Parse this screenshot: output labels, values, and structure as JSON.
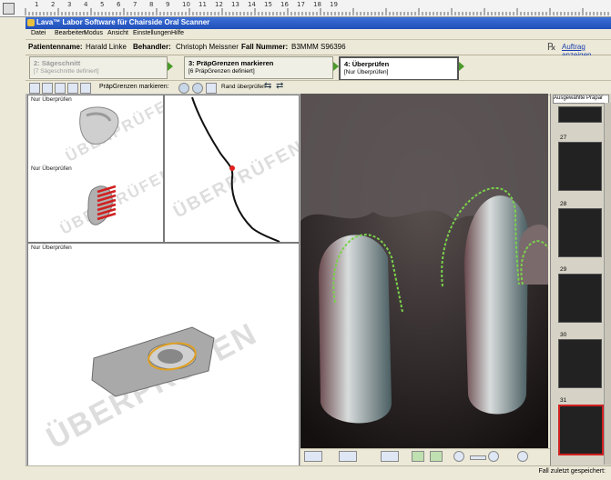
{
  "window": {
    "title": "Lava™ Labor Software für Chairside Oral Scanner"
  },
  "ruler": {
    "numbers": [
      "1",
      "2",
      "3",
      "4",
      "5",
      "6",
      "7",
      "8",
      "9",
      "10",
      "11",
      "12",
      "13",
      "14",
      "15",
      "16",
      "17",
      "18",
      "19"
    ]
  },
  "menu": [
    "Datei",
    "Bearbeiten",
    "Modus",
    "Ansicht",
    "Einstellungen",
    "Hilfe"
  ],
  "patient": {
    "name_label": "Patientenname:",
    "name": "Harald Linke",
    "doctor_label": "Behandler:",
    "doctor": "Christoph Meissner",
    "case_label": "Fall Nummer:",
    "case": "B3MMM S96396",
    "order_link": "Auftrag anzeigen"
  },
  "steps": [
    {
      "title": "2: Sägeschnitt",
      "sub": "[7 Sägeschnitte definiert]"
    },
    {
      "title": "3: PräpGrenzen markieren",
      "sub": "[6 PräpGrenzen definiert]"
    },
    {
      "title": "4: Überprüfen",
      "sub": "[Nur Überprüfen]"
    }
  ],
  "toolbar": {
    "prep_label": "PräpGrenzen markieren:",
    "edge_label": "Rand überprüfen"
  },
  "panels": {
    "top_left_a": "Nur Überprüfen",
    "top_left_b": "Nur Überprüfen",
    "bottom_left": "Nur Überprüfen",
    "watermark": "ÜBERPRÜFEN"
  },
  "sidebar": {
    "header": "Ausgewählte Präpar",
    "thumbs": [
      "27",
      "28",
      "29",
      "30",
      "31"
    ]
  },
  "status": {
    "text": "Fall zuletzt gespeichert:"
  }
}
